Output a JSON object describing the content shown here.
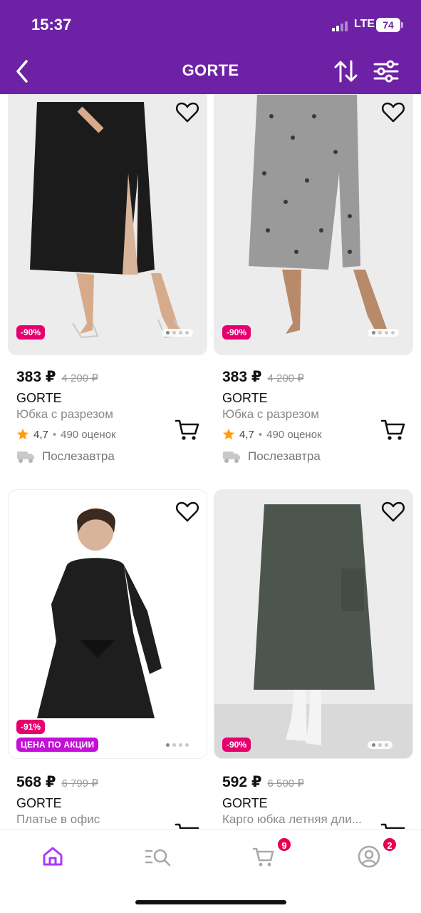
{
  "status_bar": {
    "time": "15:37",
    "network": "LTE",
    "battery": "74"
  },
  "header": {
    "title": "GORTE"
  },
  "products": [
    {
      "price": "383 ₽",
      "old_price": "4 200 ₽",
      "brand": "GORTE",
      "name": "Юбка с разрезом",
      "rating": "4,7",
      "reviews": "490 оценок",
      "delivery": "Послезавтра",
      "discount": "-90%",
      "promo": null
    },
    {
      "price": "383 ₽",
      "old_price": "4 200 ₽",
      "brand": "GORTE",
      "name": "Юбка с разрезом",
      "rating": "4,7",
      "reviews": "490 оценок",
      "delivery": "Послезавтра",
      "discount": "-90%",
      "promo": null
    },
    {
      "price": "568 ₽",
      "old_price": "6 799 ₽",
      "brand": "GORTE",
      "name": "Платье в офис",
      "discount": "-91%",
      "promo": "ЦЕНА ПО АКЦИИ"
    },
    {
      "price": "592 ₽",
      "old_price": "6 500 ₽",
      "brand": "GORTE",
      "name": "Карго юбка летняя дли...",
      "discount": "-90%",
      "promo": null
    }
  ],
  "tabbar": {
    "cart_badge": "9",
    "profile_badge": "2"
  },
  "colors": {
    "brand": "#6d22a6",
    "discount": "#e6006e",
    "promo": "#c40fd8",
    "badge": "#e6004f",
    "star": "#ff9e0d",
    "tab_active": "#a73afd"
  },
  "icons": [
    "back-arrow-icon",
    "sort-icon",
    "filter-icon",
    "heart-icon",
    "cart-icon",
    "star-icon",
    "truck-icon",
    "home-icon",
    "catalog-search-icon",
    "cart-tab-icon",
    "profile-icon"
  ]
}
